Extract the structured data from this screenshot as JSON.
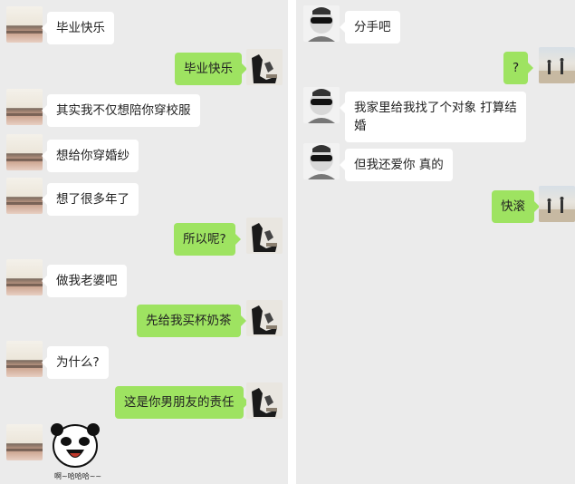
{
  "left_chat": {
    "m1": "毕业快乐",
    "m2": "毕业快乐",
    "m3": "其实我不仅想陪你穿校服",
    "m4": "想给你穿婚纱",
    "m5": "想了很多年了",
    "m6": "所以呢?",
    "m7": "做我老婆吧",
    "m8": "先给我买杯奶茶",
    "m9": "为什么?",
    "m10": "这是你男朋友的责任",
    "sticker_caption": "啊~哈哈哈~~"
  },
  "right_chat": {
    "m1": "分手吧",
    "m2": "?",
    "m3": "我家里给我找了个对象 打算结婚",
    "m4": "但我还爱你 真的",
    "m5": "快滚"
  },
  "icons": {
    "ocean_avatar": "ocean-sunset-avatar",
    "sketch_avatar": "sketch-figure-avatar",
    "sunglasses_avatar": "sunglasses-man-avatar",
    "beach_avatar": "beach-avatar",
    "sticker": "panda-laugh-sticker"
  },
  "colors": {
    "panel_bg": "#ebebeb",
    "incoming_bubble": "#ffffff",
    "outgoing_bubble": "#9ee361"
  }
}
